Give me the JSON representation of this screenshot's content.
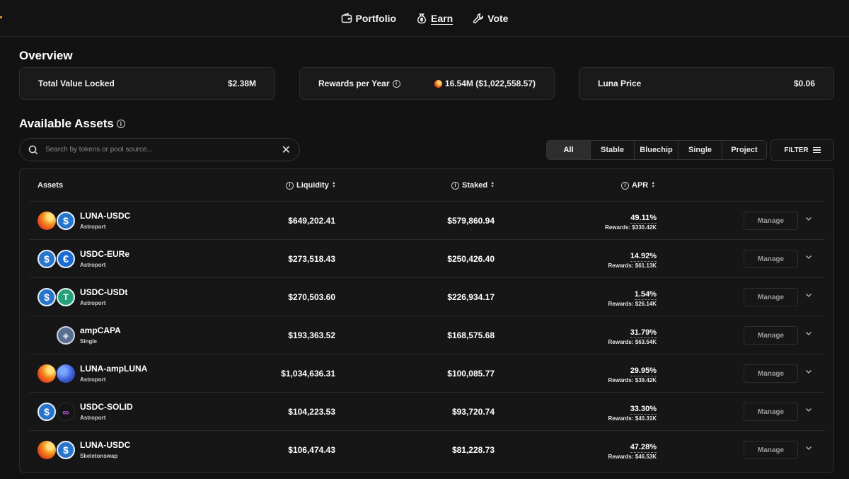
{
  "nav": {
    "items": [
      {
        "label": "Portfolio",
        "icon": "wallet-icon"
      },
      {
        "label": "Earn",
        "icon": "money-bag-icon",
        "active": true
      },
      {
        "label": "Vote",
        "icon": "wrench-icon"
      }
    ]
  },
  "overview": {
    "title": "Overview",
    "tvl": {
      "label": "Total Value Locked",
      "value": "$2.38M"
    },
    "rewards": {
      "label": "Rewards per Year",
      "value": "16.54M ($1,022,558.57)"
    },
    "luna_price": {
      "label": "Luna Price",
      "value": "$0.06"
    }
  },
  "assets_section": {
    "title": "Available Assets",
    "search": {
      "placeholder": "Search by tokens or pool source...",
      "value": ""
    },
    "filters": [
      "All",
      "Stable",
      "Bluechip",
      "Single",
      "Project"
    ],
    "active_filter": "All",
    "filter_button": "FILTER"
  },
  "table": {
    "headers": {
      "assets": "Assets",
      "liquidity": "Liquidity",
      "staked": "Staked",
      "apr": "APR"
    },
    "manage_label": "Manage",
    "rows": [
      {
        "name": "LUNA-USDC",
        "source": "Astroport",
        "liquidity": "$649,202.41",
        "staked": "$579,860.94",
        "apr": "49.11%",
        "rewards": "Rewards: $330.42K",
        "icons": [
          "luna",
          "usdc"
        ]
      },
      {
        "name": "USDC-EURe",
        "source": "Astroport",
        "liquidity": "$273,518.43",
        "staked": "$250,426.40",
        "apr": "14.92%",
        "rewards": "Rewards: $61.13K",
        "icons": [
          "usdc",
          "eure"
        ]
      },
      {
        "name": "USDC-USDt",
        "source": "Astroport",
        "liquidity": "$270,503.60",
        "staked": "$226,934.17",
        "apr": "1.54%",
        "rewards": "Rewards: $26.14K",
        "icons": [
          "usdc",
          "usdt"
        ]
      },
      {
        "name": "ampCAPA",
        "source": "Single",
        "liquidity": "$193,363.52",
        "staked": "$168,575.68",
        "apr": "31.79%",
        "rewards": "Rewards: $63.54K",
        "icons": [
          "capa"
        ]
      },
      {
        "name": "LUNA-ampLUNA",
        "source": "Astroport",
        "liquidity": "$1,034,636.31",
        "staked": "$100,085.77",
        "apr": "29.95%",
        "rewards": "Rewards: $39.42K",
        "icons": [
          "luna",
          "ampluna"
        ]
      },
      {
        "name": "USDC-SOLID",
        "source": "Astroport",
        "liquidity": "$104,223.53",
        "staked": "$93,720.74",
        "apr": "33.30%",
        "rewards": "Rewards: $40.31K",
        "icons": [
          "usdc",
          "solid"
        ]
      },
      {
        "name": "LUNA-USDC",
        "source": "Skeletonswap",
        "liquidity": "$106,474.43",
        "staked": "$81,228.73",
        "apr": "47.28%",
        "rewards": "Rewards: $46.53K",
        "icons": [
          "luna",
          "usdc"
        ]
      }
    ]
  }
}
